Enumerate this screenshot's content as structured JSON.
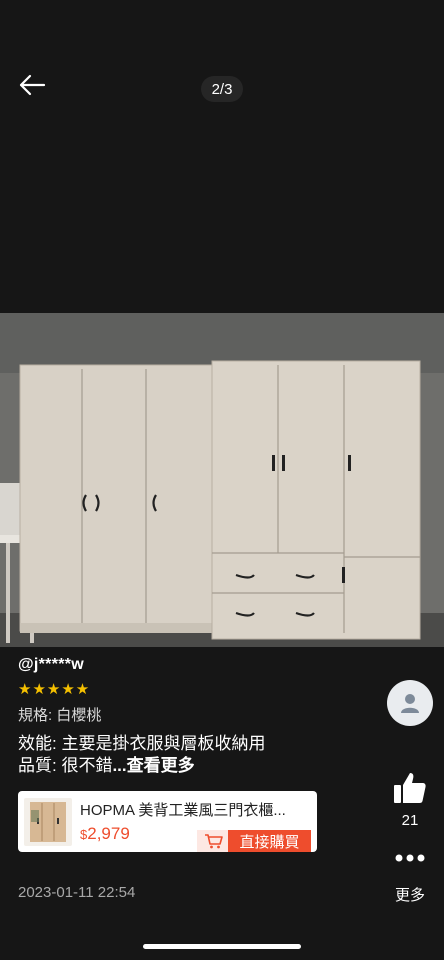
{
  "header": {
    "page_indicator": "2/3"
  },
  "review": {
    "user": "@j*****w",
    "stars": "★★★★★",
    "rating": 5,
    "spec": "規格: 白櫻桃",
    "line1": "效能: 主要是掛衣服與層板收納用",
    "line2": "品質: 很不錯",
    "more_link": "...查看更多",
    "date": "2023-01-11 22:54"
  },
  "product": {
    "title": "HOPMA 美背工業風三門衣櫃...",
    "currency": "$",
    "price": "2,979",
    "buy_label": "直接購買"
  },
  "side": {
    "like_count": "21",
    "more_label": "更多"
  },
  "colors": {
    "accent": "#ee4d2d",
    "star": "#f5c000",
    "background": "#161616"
  }
}
